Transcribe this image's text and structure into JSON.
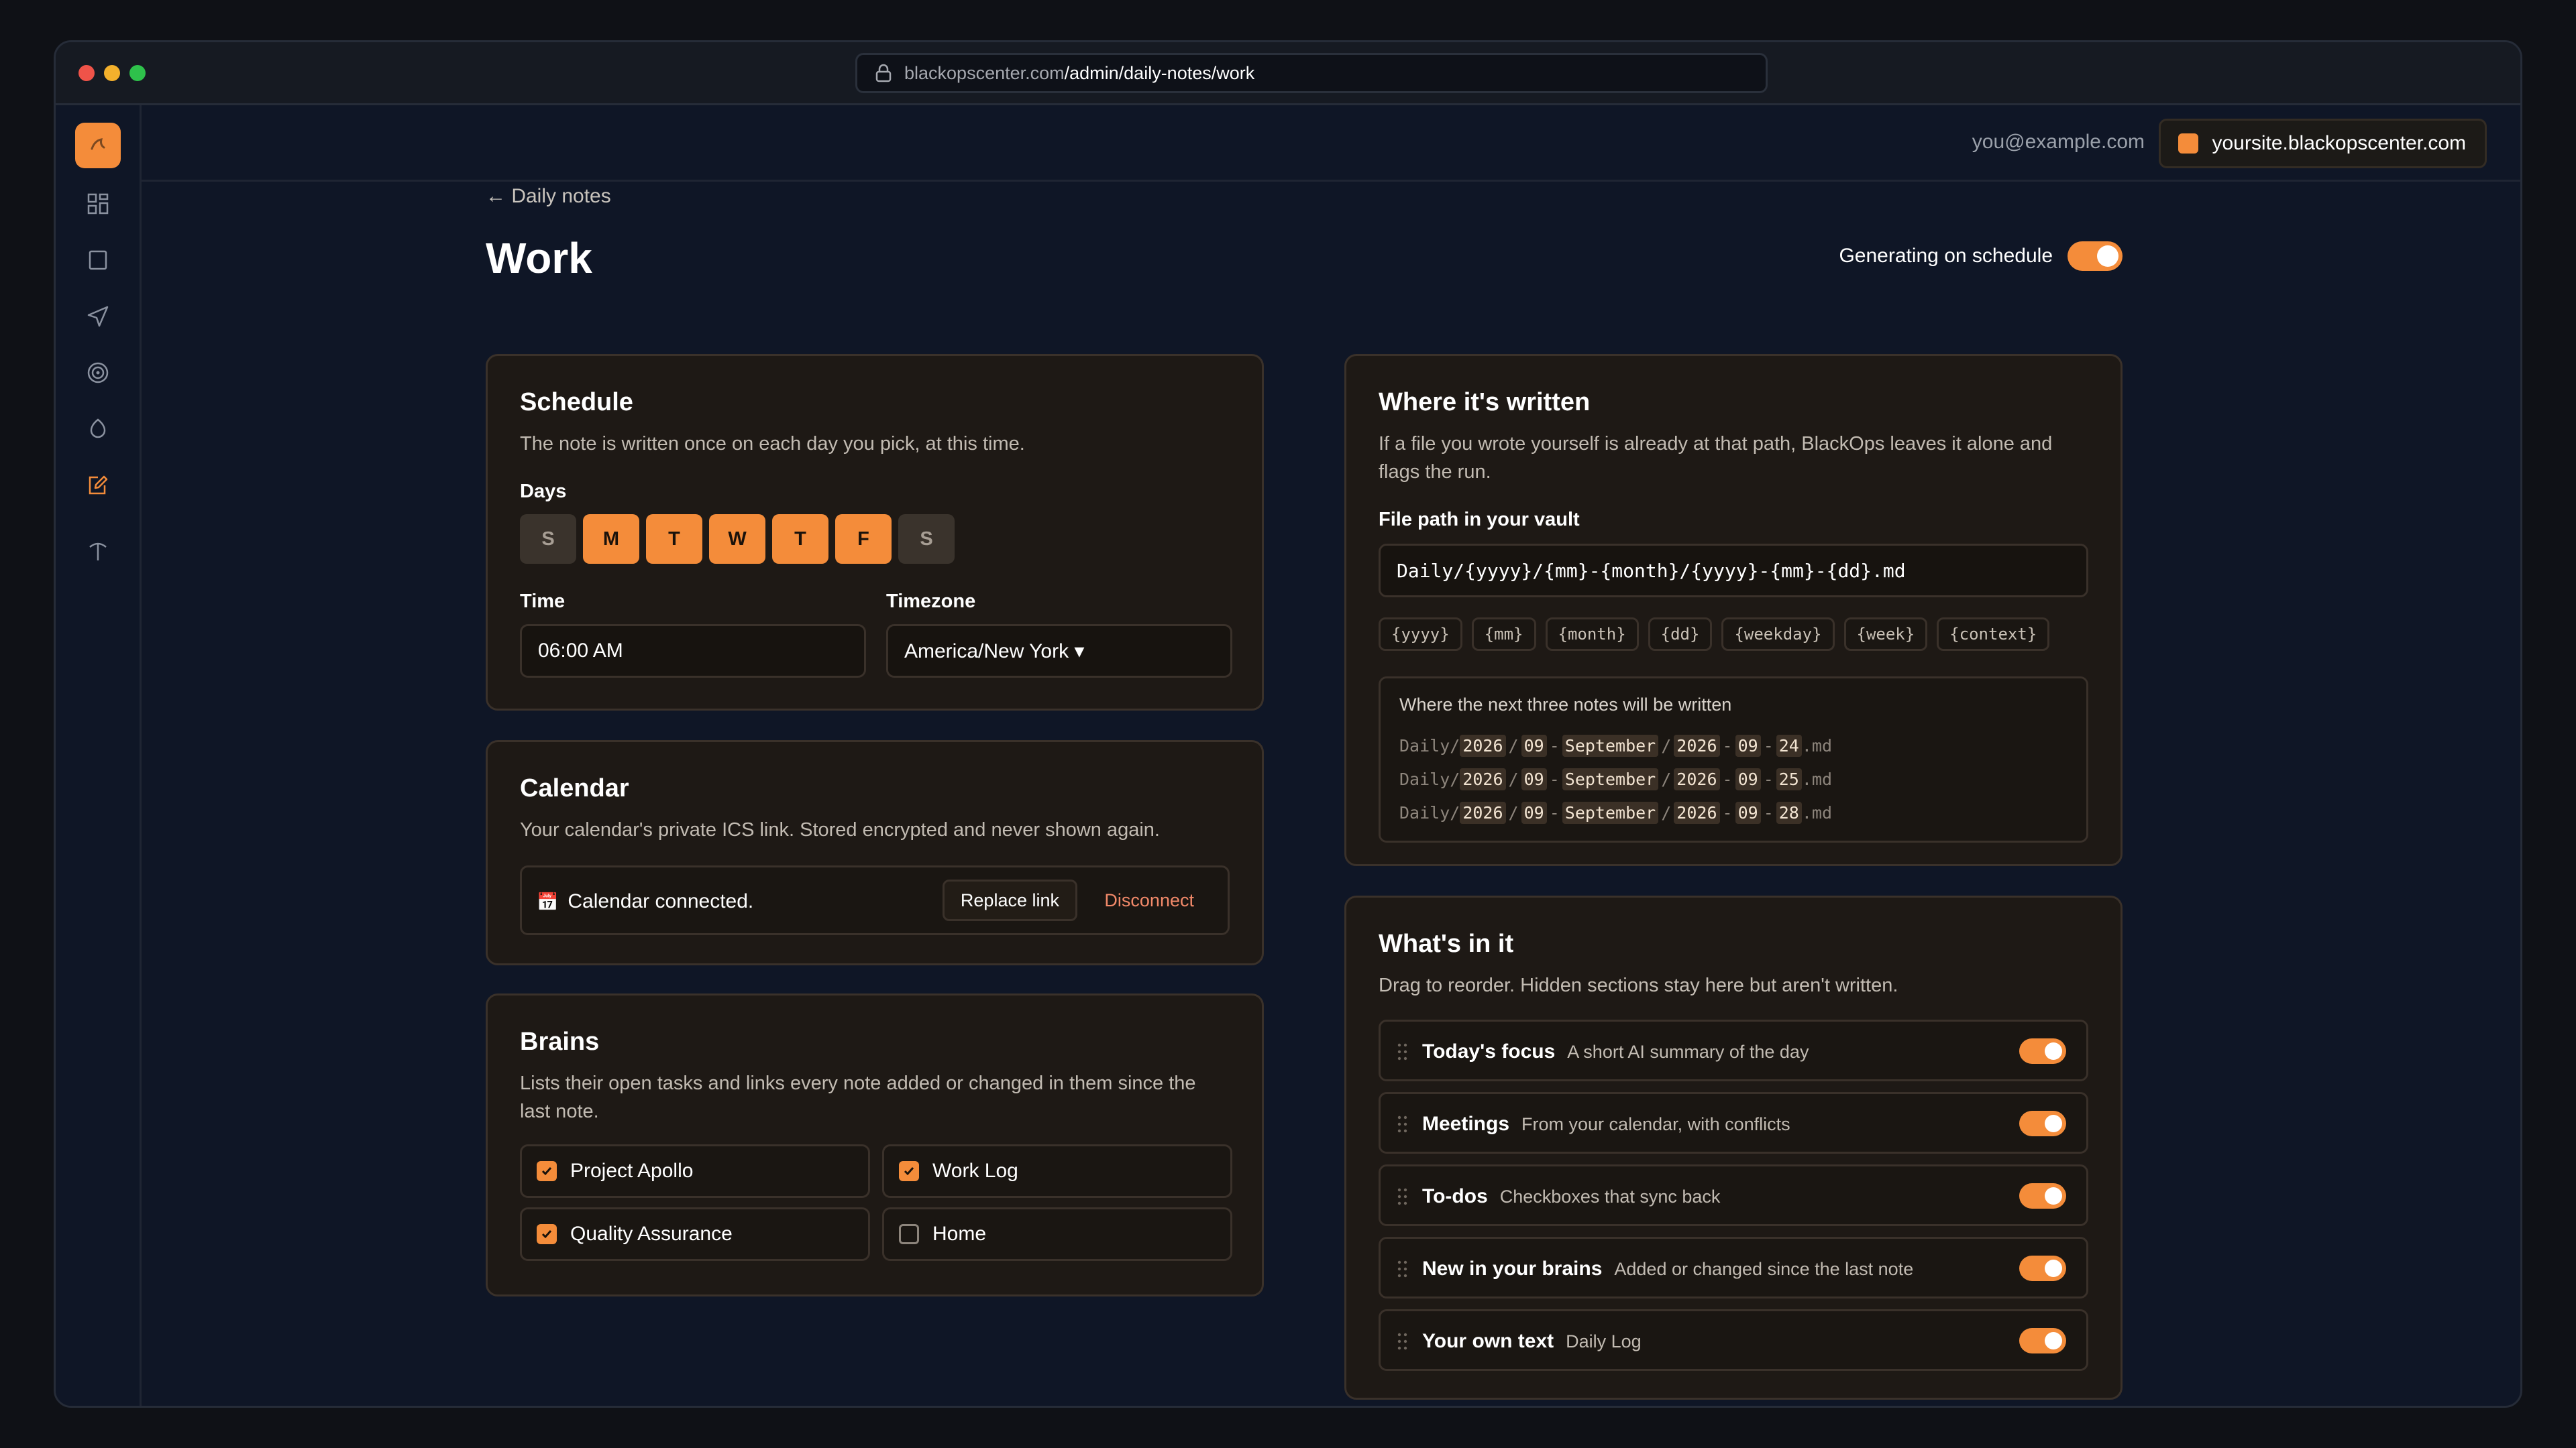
{
  "browser": {
    "url_domain": "blackopscenter.com",
    "url_path": "/admin/daily-notes/work"
  },
  "sidebar": {
    "icons": [
      "dashboard-icon",
      "square-icon",
      "send-icon",
      "target-icon",
      "drop-icon",
      "edit-note-icon",
      "pin-icon"
    ],
    "active": "edit-note-icon"
  },
  "topbar": {
    "email": "you@example.com",
    "site": "yoursite.blackopscenter.com"
  },
  "page": {
    "back_label": "← Daily notes",
    "title": "Work",
    "schedule_toggle_label": "Generating on schedule",
    "schedule_toggle_on": true
  },
  "schedule": {
    "title": "Schedule",
    "description": "The note is written once on each day you pick, at this time.",
    "days_label": "Days",
    "days": [
      {
        "label": "S",
        "on": false
      },
      {
        "label": "M",
        "on": true
      },
      {
        "label": "T",
        "on": true
      },
      {
        "label": "W",
        "on": true
      },
      {
        "label": "T",
        "on": true
      },
      {
        "label": "F",
        "on": true
      },
      {
        "label": "S",
        "on": false
      }
    ],
    "time_label": "Time",
    "time_value": "06:00 AM",
    "timezone_label": "Timezone",
    "timezone_value": "America/New York ▾"
  },
  "calendar": {
    "title": "Calendar",
    "description": "Your calendar's private ICS link. Stored encrypted and never shown again.",
    "status": "Calendar connected.",
    "replace_label": "Replace link",
    "disconnect_label": "Disconnect"
  },
  "brains": {
    "title": "Brains",
    "description_line1": "Lists their open tasks and links every note added or changed in them since the",
    "description_line2": "last note.",
    "items": [
      {
        "label": "Project Apollo",
        "checked": true
      },
      {
        "label": "Work Log",
        "checked": true
      },
      {
        "label": "Quality Assurance",
        "checked": true
      },
      {
        "label": "Home",
        "checked": false
      }
    ]
  },
  "where": {
    "title": "Where it's written",
    "description_line1": "If a file you wrote yourself is already at that path, BlackOps leaves it alone and",
    "description_line2": "flags the run.",
    "path_label": "File path in your vault",
    "path_value": "Daily/{yyyy}/{mm}-{month}/{yyyy}-{mm}-{dd}.md",
    "tokens": [
      "{yyyy}",
      "{mm}",
      "{month}",
      "{dd}",
      "{weekday}",
      "{week}",
      "{context}"
    ],
    "preview_title": "Where the next three notes will be written",
    "preview_lines": [
      {
        "prefix": "Daily/",
        "yyyy": "2026",
        "mm": "09",
        "month": "September",
        "yyyy2": "2026",
        "mm2": "09",
        "dd": "24",
        "ext": ".md"
      },
      {
        "prefix": "Daily/",
        "yyyy": "2026",
        "mm": "09",
        "month": "September",
        "yyyy2": "2026",
        "mm2": "09",
        "dd": "25",
        "ext": ".md"
      },
      {
        "prefix": "Daily/",
        "yyyy": "2026",
        "mm": "09",
        "month": "September",
        "yyyy2": "2026",
        "mm2": "09",
        "dd": "28",
        "ext": ".md"
      }
    ]
  },
  "contents": {
    "title": "What's in it",
    "description": "Drag to reorder. Hidden sections stay here but aren't written.",
    "sections": [
      {
        "name": "Today's focus",
        "desc": "A short AI summary of the day",
        "on": true
      },
      {
        "name": "Meetings",
        "desc": "From your calendar, with conflicts",
        "on": true
      },
      {
        "name": "To-dos",
        "desc": "Checkboxes that sync back",
        "on": true
      },
      {
        "name": "New in your brains",
        "desc": "Added or changed since the last note",
        "on": true
      },
      {
        "name": "Your own text",
        "desc": "Daily Log",
        "on": true
      }
    ]
  },
  "colors": {
    "accent": "#f48c3a",
    "card_bg": "#1e1915",
    "page_bg": "#0f1626",
    "danger_text": "#f38a6a"
  }
}
